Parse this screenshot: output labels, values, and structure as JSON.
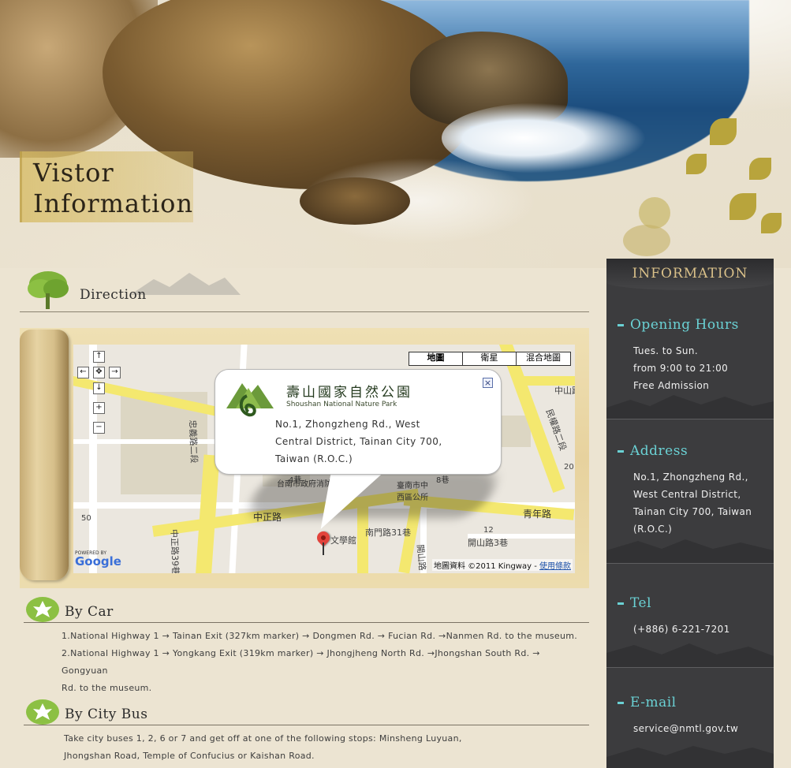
{
  "hero": {
    "title_line1": "Vistor",
    "title_line2": "Information"
  },
  "direction": {
    "label": "Direction"
  },
  "map": {
    "type_buttons": [
      "地圖",
      "衛星",
      "混合地圖"
    ],
    "controls": {
      "up": "↑",
      "left": "←",
      "center": "✥",
      "right": "→",
      "down": "↓",
      "zoom_in": "+",
      "zoom_out": "−"
    },
    "popup": {
      "park_name_zh": "壽山國家自然公園",
      "park_name_en": "Shoushan National Nature Park",
      "address_line1": "No.1, Zhongzheng Rd., West",
      "address_line2": "Central District, Tainan City 700,",
      "address_line3": "Taiwan (R.O.C.)",
      "close": "×"
    },
    "street_labels": {
      "zhongzheng": "中正路",
      "qingnian": "青年路",
      "nanmen31": "南門路31巷",
      "kaishan3": "開山路3巷",
      "zhongshan": "中山路",
      "minquan": "民權路二段",
      "zhongyi": "忠義路二段",
      "kaishan": "開山路",
      "nanmen": "南門路",
      "zhongzheng39": "中正路39巷",
      "fire_station": "台南市政府消防局",
      "district_office": "臺南市中西區公所",
      "museum": "文學館",
      "num_50": "50",
      "num_12": "12",
      "num_20": "20",
      "num_4": "4巷",
      "num_8": "8巷"
    },
    "attribution": "地圖資料 ©2011 Kingway -",
    "terms_link": "使用條款",
    "powered_by": "POWERED BY",
    "google": "Google"
  },
  "by_car": {
    "title": "By Car",
    "line1": "1.National Highway 1 → Tainan Exit (327km marker) → Dongmen Rd. → Fucian Rd. →Nanmen Rd. to the museum.",
    "line2": "2.National Highway 1 → Yongkang Exit (319km marker) → Jhongjheng North Rd. →Jhongshan South Rd. → Gongyuan",
    "line3": "Rd. to the museum."
  },
  "by_bus": {
    "title": "By City Bus",
    "line1": "Take city buses 1, 2, 6 or 7 and get off at one of the following stops: Minsheng Luyuan,",
    "line2": "Jhongshan Road, Temple of Confucius or Kaishan Road."
  },
  "sidebar": {
    "header": "INFORMATION",
    "opening": {
      "title": "Opening Hours",
      "line1": "Tues. to Sun.",
      "line2": "from 9:00 to 21:00",
      "line3": "Free Admission"
    },
    "address": {
      "title": "Address",
      "line1": "No.1, Zhongzheng Rd.,",
      "line2": "West Central District,",
      "line3": "Tainan City 700, Taiwan",
      "line4": "(R.O.C.)"
    },
    "tel": {
      "title": "Tel",
      "value": "(+886) 6-221-7201"
    },
    "email": {
      "title": "E-mail",
      "value": "service@nmtl.gov.tw"
    }
  },
  "colors": {
    "sidebar_bg": "#3c3c3e",
    "sidebar_title": "#6ad1d4",
    "sidebar_header": "#d9c089",
    "map_road": "#f4e86f"
  }
}
